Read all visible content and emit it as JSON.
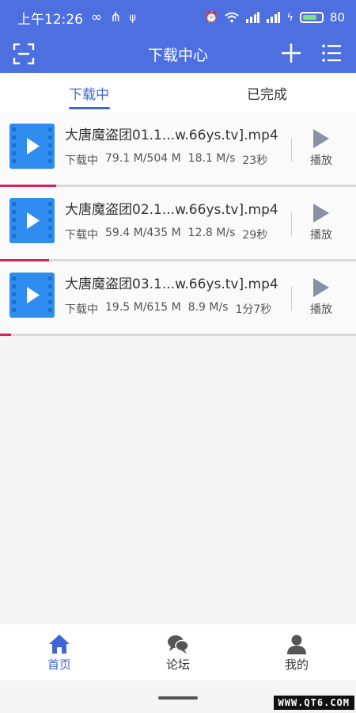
{
  "statusbar": {
    "time": "上午12:26",
    "battery_level": "80",
    "battery_fraction": 0.8
  },
  "appbar": {
    "title": "下载中心",
    "icons": {
      "left": "scan-icon",
      "add": "plus-icon",
      "menu": "list-icon"
    }
  },
  "tabs": [
    {
      "label": "下载中",
      "active": true
    },
    {
      "label": "已完成",
      "active": false
    }
  ],
  "downloads": [
    {
      "filename": "大唐魔盗团01.1...w.66ys.tv].mp4",
      "status": "下载中",
      "size": "79.1 M/504 M",
      "speed": "18.1 M/s",
      "remaining": "23秒",
      "play_label": "播放",
      "progress": 0.157
    },
    {
      "filename": "大唐魔盗团02.1...w.66ys.tv].mp4",
      "status": "下载中",
      "size": "59.4 M/435 M",
      "speed": "12.8 M/s",
      "remaining": "29秒",
      "play_label": "播放",
      "progress": 0.137
    },
    {
      "filename": "大唐魔盗团03.1...w.66ys.tv].mp4",
      "status": "下载中",
      "size": "19.5 M/615 M",
      "speed": "8.9 M/s",
      "remaining": "1分7秒",
      "play_label": "播放",
      "progress": 0.032
    }
  ],
  "bottomnav": [
    {
      "label": "首页",
      "icon": "home-icon",
      "active": true
    },
    {
      "label": "论坛",
      "icon": "chat-icon",
      "active": false
    },
    {
      "label": "我的",
      "icon": "user-icon",
      "active": false
    }
  ],
  "colors": {
    "primary": "#4d6fe0",
    "tab_active": "#3f66d8",
    "progress": "#d6245a",
    "thumb": "#2f8df0"
  },
  "watermark": "WWW.QT6.COM"
}
